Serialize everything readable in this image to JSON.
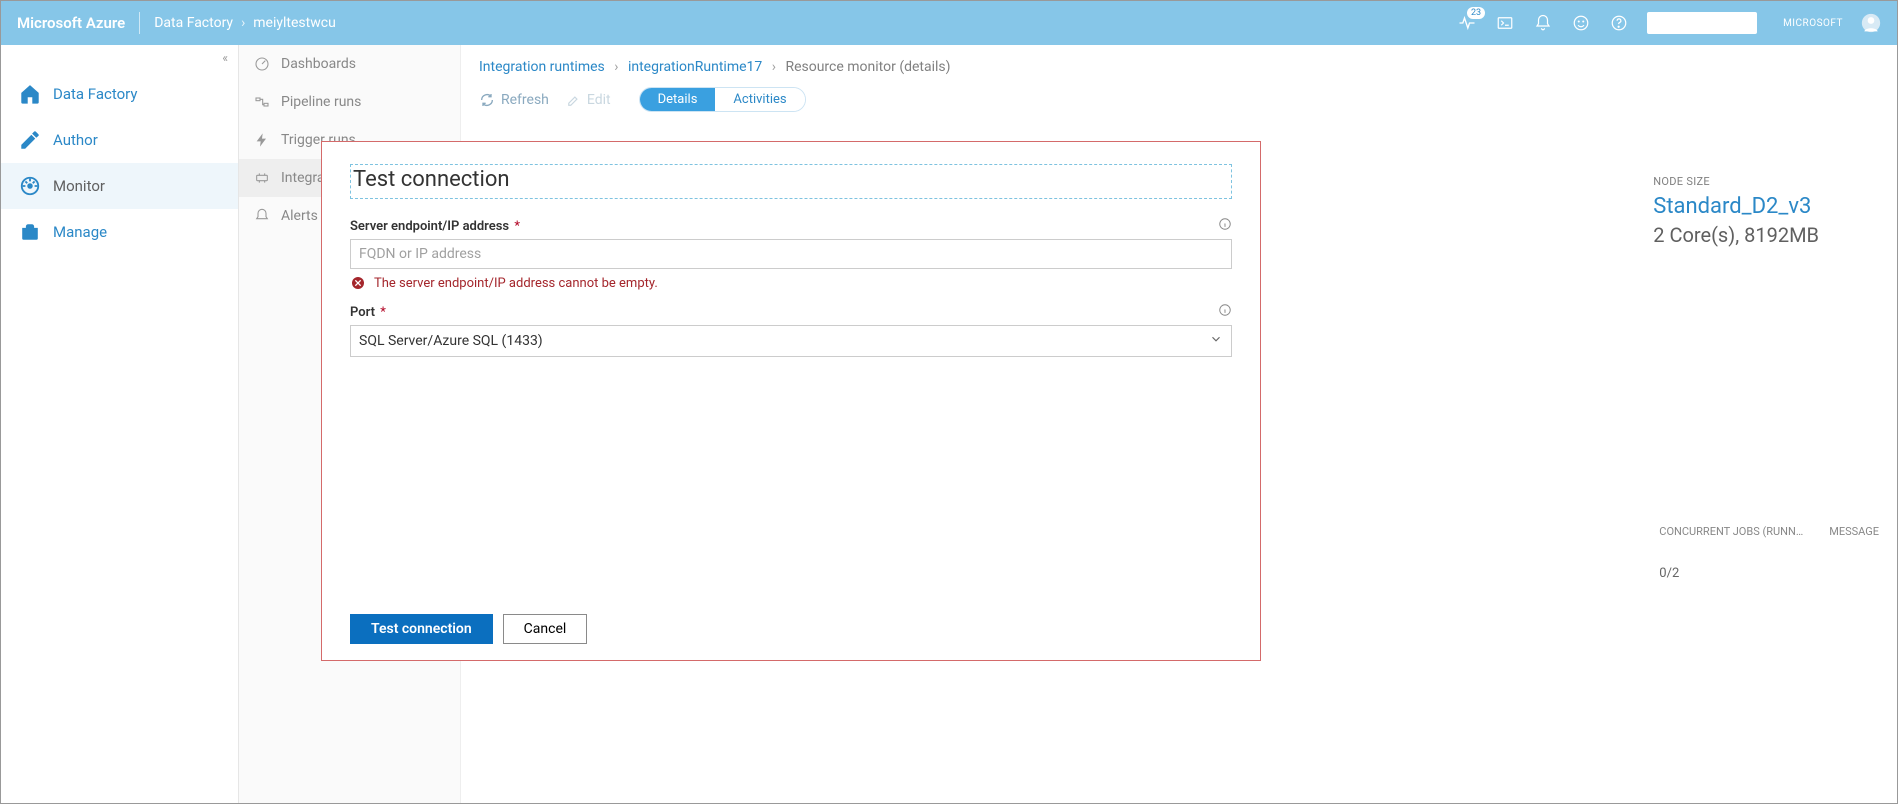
{
  "header": {
    "brand": "Microsoft Azure",
    "breadcrumb_service": "Data Factory",
    "breadcrumb_resource": "meiyltestwcu",
    "notification_count": "23",
    "account_org": "MICROSOFT"
  },
  "left_nav": {
    "items": [
      {
        "label": "Data Factory"
      },
      {
        "label": "Author"
      },
      {
        "label": "Monitor"
      },
      {
        "label": "Manage"
      }
    ]
  },
  "monitor_nav": {
    "items": [
      {
        "label": "Dashboards"
      },
      {
        "label": "Pipeline runs"
      },
      {
        "label": "Trigger runs"
      },
      {
        "label": "Integrati…"
      },
      {
        "label": "Alerts &…"
      }
    ]
  },
  "main": {
    "crumb_root": "Integration runtimes",
    "crumb_runtime": "integrationRuntime17",
    "crumb_page": "Resource monitor (details)",
    "toolbar": {
      "refresh": "Refresh",
      "edit": "Edit",
      "tab_details": "Details",
      "tab_activities": "Activities"
    },
    "node": {
      "size_label": "NODE SIZE",
      "size_value": "Standard_D2_v3",
      "size_spec": "2 Core(s), 8192MB"
    },
    "table": {
      "col_concurrent": "CONCURRENT JOBS (RUNN…",
      "col_message": "MESSAGE",
      "row_concurrent": "0/2"
    }
  },
  "modal": {
    "title": "Test connection",
    "server": {
      "label": "Server endpoint/IP address",
      "placeholder": "FQDN or IP address",
      "value": "",
      "error": "The server endpoint/IP address cannot be empty."
    },
    "port": {
      "label": "Port",
      "selected": "SQL Server/Azure SQL (1433)"
    },
    "buttons": {
      "test": "Test connection",
      "cancel": "Cancel"
    }
  }
}
